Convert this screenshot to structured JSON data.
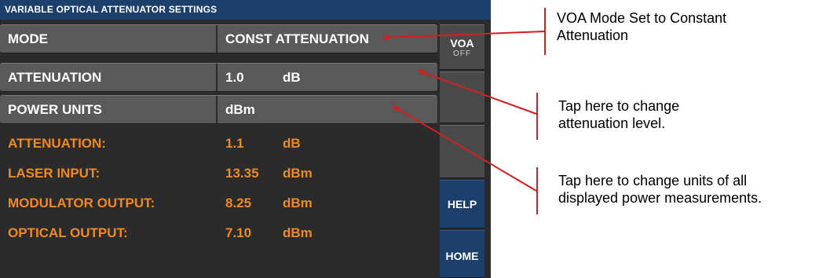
{
  "title": "VARIABLE OPTICAL ATTENUATOR SETTINGS",
  "settings": [
    {
      "label": "MODE",
      "value": "CONST ATTENUATION",
      "unit": ""
    },
    {
      "label": "ATTENUATION",
      "value": "1.0",
      "unit": "dB"
    },
    {
      "label": "POWER UNITS",
      "value": "dBm",
      "unit": ""
    }
  ],
  "readings": [
    {
      "label": "ATTENUATION:",
      "value": "1.1",
      "unit": "dB"
    },
    {
      "label": "LASER INPUT:",
      "value": "13.35",
      "unit": "dBm"
    },
    {
      "label": "MODULATOR OUTPUT:",
      "value": "8.25",
      "unit": "dBm"
    },
    {
      "label": "OPTICAL OUTPUT:",
      "value": "7.10",
      "unit": "dBm"
    }
  ],
  "side_buttons": {
    "voa": {
      "label": "VOA",
      "sub": "OFF"
    },
    "help": {
      "label": "HELP"
    },
    "home": {
      "label": "HOME"
    }
  },
  "callouts": {
    "mode": [
      "VOA Mode Set to Constant",
      "Attenuation"
    ],
    "attenuation": [
      "Tap here to change",
      "attenuation level."
    ],
    "units": [
      "Tap here to change units of all",
      "displayed power measurements."
    ]
  },
  "colors": {
    "title_bar": "#1d3f6c",
    "reading_text": "#f08a1e",
    "annotation": "#d02020"
  }
}
